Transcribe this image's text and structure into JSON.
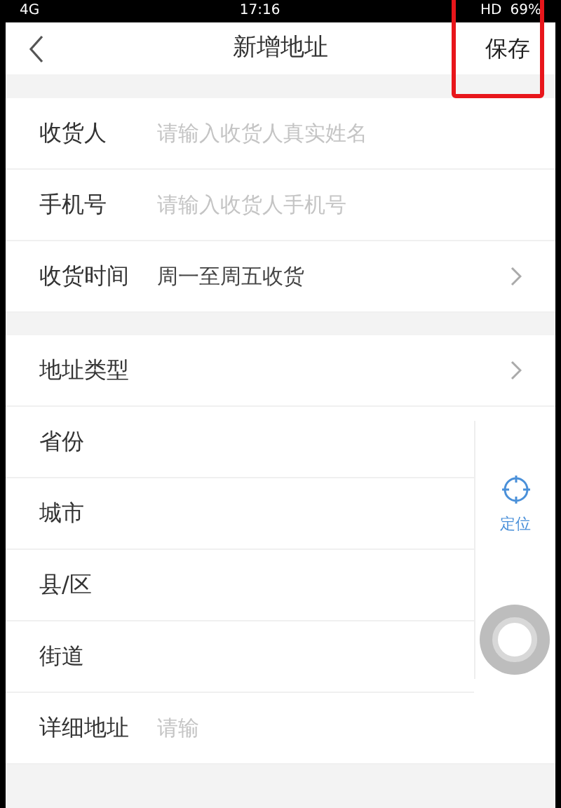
{
  "status_bar": {
    "network": "4G",
    "time": "17:16",
    "hd": "HD",
    "battery": "69%"
  },
  "header": {
    "title": "新增地址",
    "save": "保存",
    "save_highlighted": true
  },
  "contact_rows": [
    {
      "label": "收货人",
      "placeholder": "请输入收货人真实姓名",
      "kind": "input"
    },
    {
      "label": "手机号",
      "placeholder": "请输入收货人手机号",
      "kind": "input"
    },
    {
      "label": "收货时间",
      "value": "周一至周五收货",
      "kind": "select"
    }
  ],
  "address_rows": [
    {
      "label": "地址类型",
      "kind": "select"
    },
    {
      "label": "省份",
      "kind": "plain"
    },
    {
      "label": "城市",
      "kind": "plain"
    },
    {
      "label": "县/区",
      "kind": "plain"
    },
    {
      "label": "街道",
      "kind": "plain"
    },
    {
      "label": "详细地址",
      "placeholder": "请输",
      "kind": "input"
    }
  ],
  "locate": {
    "label": "定位"
  }
}
